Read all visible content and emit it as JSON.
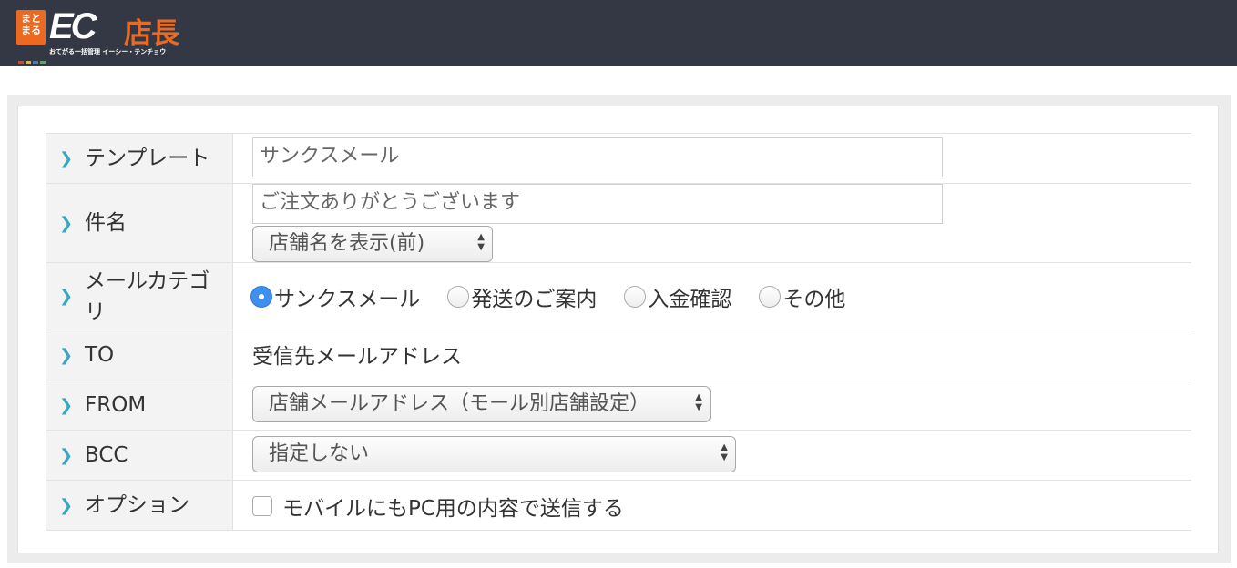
{
  "header": {
    "logo_badge": "まと\nまる",
    "logo_ec": "EC",
    "logo_tencho": "店長",
    "logo_sub": "おてがる一括管理 イーシー・テンチョウ"
  },
  "form": {
    "template": {
      "label": "テンプレート",
      "value": "サンクスメール"
    },
    "subject": {
      "label": "件名",
      "value": "ご注文ありがとうございます",
      "shop_name_select": "店舗名を表示(前)"
    },
    "category": {
      "label_line1": "メールカテゴ",
      "label_line2": "リ",
      "options": [
        "サンクスメール",
        "発送のご案内",
        "入金確認",
        "その他"
      ],
      "selected_index": 0
    },
    "to": {
      "label": "TO",
      "value": "受信先メールアドレス"
    },
    "from": {
      "label": "FROM",
      "value": "店舗メールアドレス（モール別店舗設定）"
    },
    "bcc": {
      "label": "BCC",
      "value": "指定しない"
    },
    "option": {
      "label": "オプション",
      "checkbox_label": "モバイルにもPC用の内容で送信する",
      "checked": false
    }
  },
  "icons": {
    "row_marker": "chevron-right-icon",
    "accent": "#3aa7c0",
    "brand": "#ea6a22",
    "header_bg": "#343844"
  }
}
